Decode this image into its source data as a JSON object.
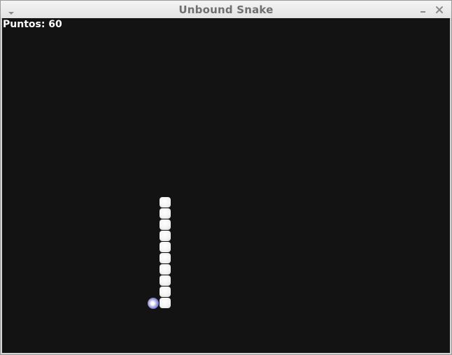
{
  "window": {
    "title": "Unbound Snake"
  },
  "titlebar": {
    "menu_icon": "chevron-down-icon",
    "minimize_icon": "minimize-icon",
    "close_icon": "close-icon"
  },
  "game": {
    "score_text": "Puntos: 60",
    "background_color": "#131313",
    "snake_color": "#f2f2f2",
    "food_color": "#6a6acb",
    "snake_segments": 10
  }
}
